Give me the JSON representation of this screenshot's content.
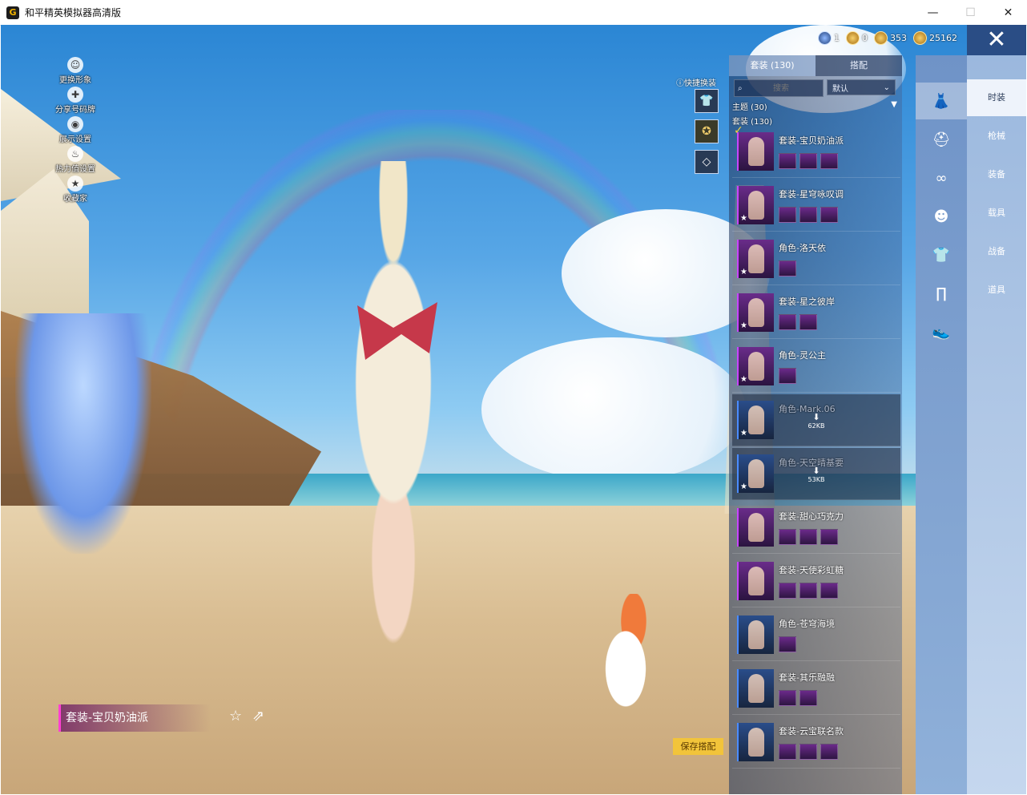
{
  "window": {
    "title": "和平精英模拟器高清版",
    "controls": {
      "minimize": "—",
      "maximize": "☐",
      "close": "✕"
    }
  },
  "left_menu": [
    {
      "label": "更换形象",
      "icon": "person-icon"
    },
    {
      "label": "分享号码牌",
      "icon": "share-badge-icon"
    },
    {
      "label": "展示设置",
      "icon": "eye-icon"
    },
    {
      "label": "热力值设置",
      "icon": "fire-icon"
    },
    {
      "label": "收藏家",
      "icon": "collector-icon"
    }
  ],
  "currency": [
    {
      "value": "1",
      "icon": "globe-coin-icon"
    },
    {
      "value": "0",
      "icon": "coin-icon"
    },
    {
      "value": "353",
      "icon": "gold-coin-icon"
    },
    {
      "value": "25162",
      "icon": "gold-coin-icon"
    }
  ],
  "quick_change": {
    "label": "快捷换装"
  },
  "outfit_panel": {
    "tabs": [
      {
        "label": "套装 (130)",
        "active": true
      },
      {
        "label": "搭配",
        "active": false
      }
    ],
    "search_placeholder": "搜索",
    "sort_label": "默认",
    "theme_header": "主题 (30)",
    "suit_header": "套装 (130)",
    "items": [
      {
        "name": "套装-宝贝奶油派",
        "selected": true,
        "minis": 3,
        "dim": false
      },
      {
        "name": "套装-星穹咏叹调",
        "selected": false,
        "minis": 3,
        "dim": false
      },
      {
        "name": "角色-洛天依",
        "selected": false,
        "minis": 1,
        "dim": false
      },
      {
        "name": "套装-星之彼岸",
        "selected": false,
        "minis": 2,
        "dim": false
      },
      {
        "name": "角色-灵公主",
        "selected": false,
        "minis": 1,
        "dim": false
      },
      {
        "name": "角色-Mark.06",
        "selected": false,
        "minis": 1,
        "dim": true,
        "download": "62KB"
      },
      {
        "name": "角色-天空晴基要",
        "selected": false,
        "minis": 1,
        "dim": true,
        "download": "53KB"
      },
      {
        "name": "套装-甜心巧克力",
        "selected": false,
        "minis": 3,
        "dim": false
      },
      {
        "name": "套装-天使彩虹糖",
        "selected": false,
        "minis": 3,
        "dim": false
      },
      {
        "name": "角色-苍穹海境",
        "selected": false,
        "minis": 1,
        "dim": false
      },
      {
        "name": "套装-其乐融融",
        "selected": false,
        "minis": 2,
        "dim": false
      },
      {
        "name": "套装-云宝联名款",
        "selected": false,
        "minis": 3,
        "dim": false
      }
    ]
  },
  "category_icons": [
    "outfit-icon",
    "helmet-icon",
    "glasses-icon",
    "mask-icon",
    "top-icon",
    "pants-icon",
    "shoes-icon"
  ],
  "side_tabs": [
    {
      "label": "时装",
      "active": true
    },
    {
      "label": "枪械",
      "active": false
    },
    {
      "label": "装备",
      "active": false
    },
    {
      "label": "载具",
      "active": false
    },
    {
      "label": "战备",
      "active": false
    },
    {
      "label": "道具",
      "active": false
    }
  ],
  "current_outfit": "套装-宝贝奶油派",
  "save_button": "保存搭配",
  "colors": {
    "accent_pink": "#ff3fd2",
    "save_yellow": "#f2c43a",
    "panel_blue": "#2a4d85"
  }
}
